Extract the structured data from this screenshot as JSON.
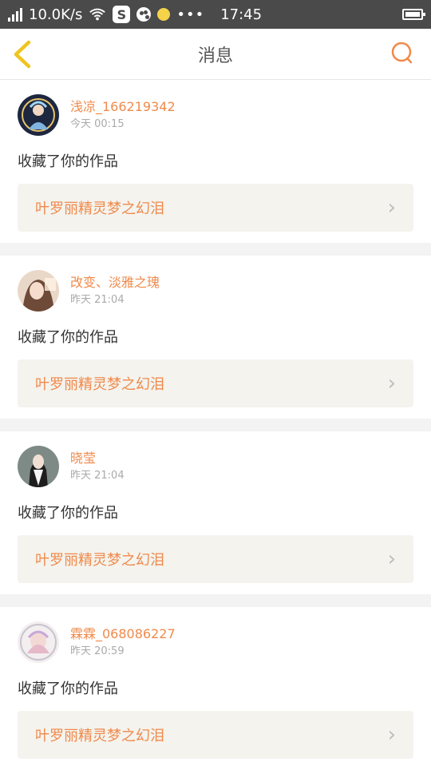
{
  "status_bar": {
    "speed": "10.0K/s",
    "time": "17:45",
    "icons": [
      "signal-icon",
      "wifi-icon",
      "s-app-icon",
      "palette-icon",
      "yellow-dot-icon",
      "more-dots-icon",
      "battery-icon"
    ]
  },
  "nav": {
    "title": "消息",
    "back_icon": "chevron-left-icon",
    "search_icon": "search-icon",
    "accent": "#f0c420"
  },
  "messages": [
    {
      "username": "浅凉_166219342",
      "time": "今天 00:15",
      "action": "收藏了你的作品",
      "work": "叶罗丽精灵梦之幻泪"
    },
    {
      "username": "改变、淡雅之瑰",
      "time": "昨天 21:04",
      "action": "收藏了你的作品",
      "work": "叶罗丽精灵梦之幻泪"
    },
    {
      "username": "晓莹",
      "time": "昨天 21:04",
      "action": "收藏了你的作品",
      "work": "叶罗丽精灵梦之幻泪"
    },
    {
      "username": "霖霖_068086227",
      "time": "昨天 20:59",
      "action": "收藏了你的作品",
      "work": "叶罗丽精灵梦之幻泪"
    }
  ],
  "colors": {
    "username": "#f08a4b",
    "status_bar": "#4a4a4a",
    "work_bg": "#f4f3ee"
  }
}
